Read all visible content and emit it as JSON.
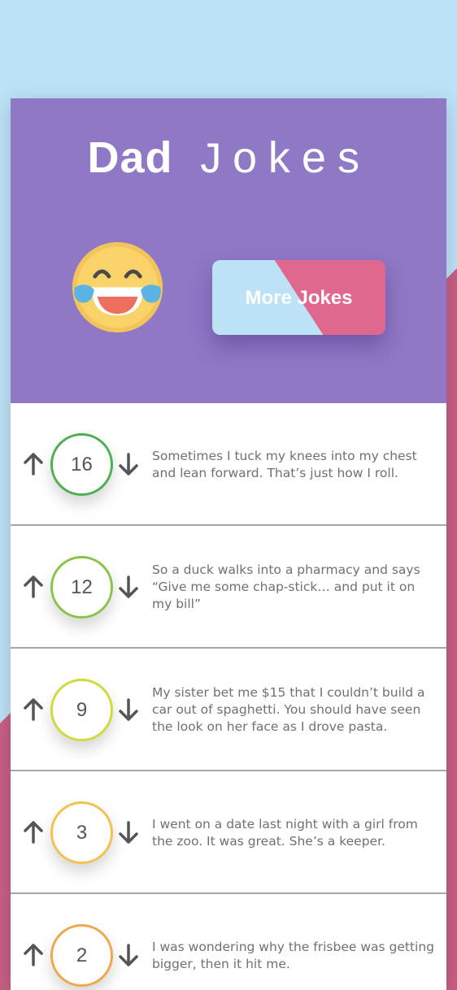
{
  "header": {
    "title_bold": "Dad",
    "title_light": "Jokes",
    "emoji": "laughing-tears-emoji",
    "more_button_label": "More Jokes"
  },
  "colors": {
    "sky": "#bde2f6",
    "pink": "#c95f86",
    "header_purple": "#8f78c6",
    "button_blue": "#bde2f6",
    "button_pink": "#e0688f"
  },
  "jokes": [
    {
      "votes": "16",
      "color": "#4caf50",
      "text": "Sometimes I tuck my knees into my chest and lean forward. That’s just how I roll."
    },
    {
      "votes": "12",
      "color": "#8bc34a",
      "text": "So a duck walks into a pharmacy and says “Give me some chap-stick… and put it on my bill”"
    },
    {
      "votes": "9",
      "color": "#cddc39",
      "text": "My sister bet me $15 that I couldn’t build a car out of spaghetti. You should have seen the look on her face as I drove pasta."
    },
    {
      "votes": "3",
      "color": "#f2c14e",
      "text": "I went on a date last night with a girl from the zoo. It was great. She’s a keeper."
    },
    {
      "votes": "2",
      "color": "#eea84a",
      "text": "I was wondering why the frisbee was getting bigger, then it hit me."
    }
  ]
}
